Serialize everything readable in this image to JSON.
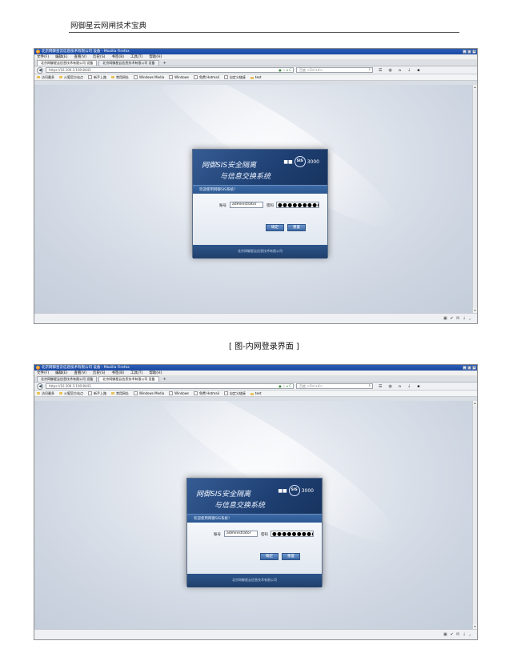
{
  "page": {
    "header": "网御星云网闸技术宝典",
    "caption": "[ 图-内网登录界面 ]"
  },
  "browser": {
    "window_title": "北京网御星云信息技术有限公司 设备 - Mozilla Firefox",
    "menu": [
      "文件(F)",
      "编辑(E)",
      "查看(V)",
      "历史(S)",
      "书签(B)",
      "工具(T)",
      "帮助(H)"
    ],
    "tabs": [
      "北京网御星云信息技术有限公司 设备",
      "北京网御星云信息技术有限公司 设备"
    ],
    "url_top": "https://10.100.3.100:8443",
    "url_bottom": "https://10.200.3.100:8443",
    "search_placeholder": "百度 <Ctrl+K>",
    "bookmarks": [
      "访问最多",
      "火狐官方站点",
      "新手上路",
      "常用网址",
      "Windows Media",
      "Windows",
      "免费 Hotmail",
      "自定义链接",
      "test"
    ]
  },
  "login": {
    "title_line1": "网御SIS安全隔离",
    "title_line2": "与信息交换系统",
    "logo_text": "SIS",
    "product_code": "3000",
    "welcome": "欢迎使用网御SIS系统！",
    "username_label": "账号",
    "username_value": "administrator",
    "password_label": "密码",
    "password_mask": "●●●●●●●●●",
    "ok_button": "确定",
    "reset_button": "重置",
    "footer": "北京网御星云信息技术有限公司"
  },
  "icons": {
    "status_bar": [
      "page-icon",
      "check-icon",
      "mail-icon",
      "download-icon",
      "resize-icon"
    ]
  }
}
